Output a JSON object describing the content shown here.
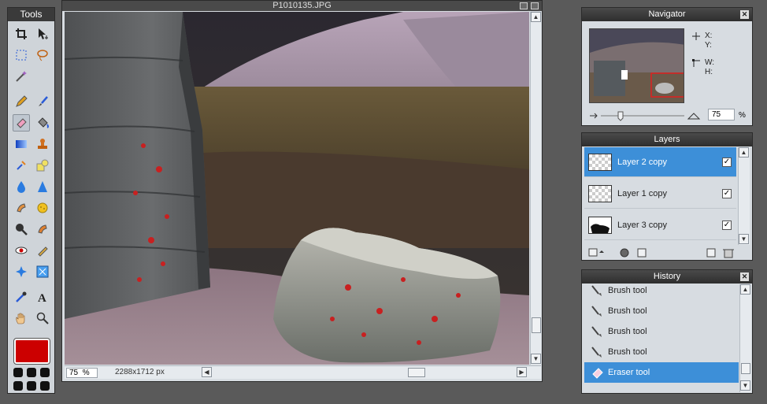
{
  "tools_panel": {
    "title": "Tools",
    "foreground_color": "#cc0000"
  },
  "canvas": {
    "title": "P1010135.JPG",
    "zoom": "75",
    "zoom_unit": "%",
    "dimensions": "2288x1712 px"
  },
  "navigator": {
    "title": "Navigator",
    "x_label": "X:",
    "y_label": "Y:",
    "w_label": "W:",
    "h_label": "H:",
    "zoom": "75",
    "zoom_unit": "%"
  },
  "layers": {
    "title": "Layers",
    "items": [
      {
        "name": "Layer 2 copy",
        "selected": true,
        "visible": true
      },
      {
        "name": "Layer 1 copy",
        "selected": false,
        "visible": true
      },
      {
        "name": "Layer 3 copy",
        "selected": false,
        "visible": true
      }
    ]
  },
  "history": {
    "title": "History",
    "items": [
      {
        "name": "Brush tool",
        "icon": "brush-icon"
      },
      {
        "name": "Brush tool",
        "icon": "brush-icon"
      },
      {
        "name": "Brush tool",
        "icon": "brush-icon"
      },
      {
        "name": "Brush tool",
        "icon": "brush-icon"
      },
      {
        "name": "Eraser tool",
        "icon": "eraser-icon",
        "selected": true
      }
    ]
  },
  "icons": {
    "tools": [
      "crop-icon",
      "move-icon",
      "marquee-icon",
      "lasso-icon",
      "magic-wand-icon",
      "blank",
      "pencil-icon",
      "brush-icon",
      "eraser-icon",
      "bucket-icon",
      "gradient-icon",
      "stamp-icon",
      "color-replace-icon",
      "shapes-icon",
      "drop-icon",
      "sharpen-icon",
      "smudge-icon",
      "sponge-icon",
      "zoom-lens-icon",
      "burn-icon",
      "red-eye-icon",
      "dodge-icon",
      "spot-heal-icon",
      "bloat-icon",
      "picker-icon",
      "type-icon",
      "hand-icon",
      "zoom-icon"
    ]
  }
}
